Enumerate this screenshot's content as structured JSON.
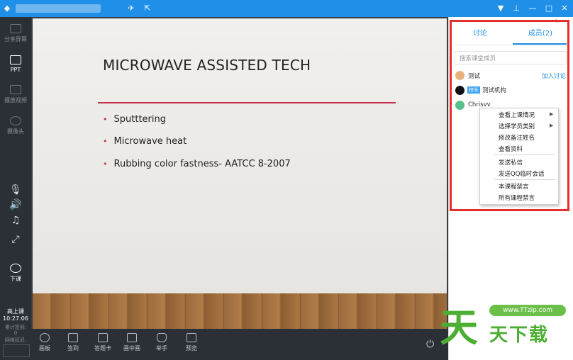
{
  "titlebar": {
    "icons": [
      "send-icon",
      "share-icon",
      "dropdown-icon",
      "pin-icon",
      "minimize-icon",
      "maximize-icon",
      "close-icon"
    ]
  },
  "sidebar": {
    "items": [
      {
        "label": "分享屏幕",
        "icon": "screen-share-icon"
      },
      {
        "label": "PPT",
        "icon": "ppt-icon"
      },
      {
        "label": "播放视频",
        "icon": "video-icon"
      },
      {
        "label": "摄像头",
        "icon": "camera-icon"
      }
    ],
    "end_label": "下课",
    "status_title": "高上课",
    "time": "10:27:06",
    "sign_label": "累计签到:",
    "sign_value": "0",
    "network_label": "网络延迟:"
  },
  "slide": {
    "title": "MICROWAVE ASSISTED TECH",
    "bullets": [
      "Sputttering",
      "Microwave heat",
      "Rubbing color fastness- AATCC 8-2007"
    ]
  },
  "toolbar": {
    "items": [
      {
        "label": "画板",
        "icon": "palette-icon"
      },
      {
        "label": "签到",
        "icon": "checkin-icon"
      },
      {
        "label": "答题卡",
        "icon": "answer-card-icon"
      },
      {
        "label": "画中画",
        "icon": "pip-icon"
      },
      {
        "label": "举手",
        "icon": "raise-hand-icon"
      },
      {
        "label": "预览",
        "icon": "preview-icon"
      }
    ]
  },
  "panel": {
    "tab_discuss": "讨论",
    "tab_members": "成员(2)",
    "search_placeholder": "搜索课堂成员",
    "members": [
      {
        "name": "测试",
        "action": "加入讨论"
      },
      {
        "badge": "校长",
        "name": "测试机构"
      },
      {
        "name": "Chrisvv"
      }
    ],
    "context_menu": [
      "查看上课情况",
      "选择学员类别",
      "修改备注姓名",
      "查看资料",
      "发送私信",
      "发送QQ临时会话",
      "本课程禁言",
      "所有课程禁言"
    ]
  },
  "watermark": {
    "url": "www.TTzip.com",
    "big": "天",
    "small": "天下载"
  },
  "colors": {
    "accent": "#1f8fe8",
    "highlight": "#e62e2e",
    "slide_accent": "#c2304a",
    "sidebar_bg": "#2b2f36"
  }
}
